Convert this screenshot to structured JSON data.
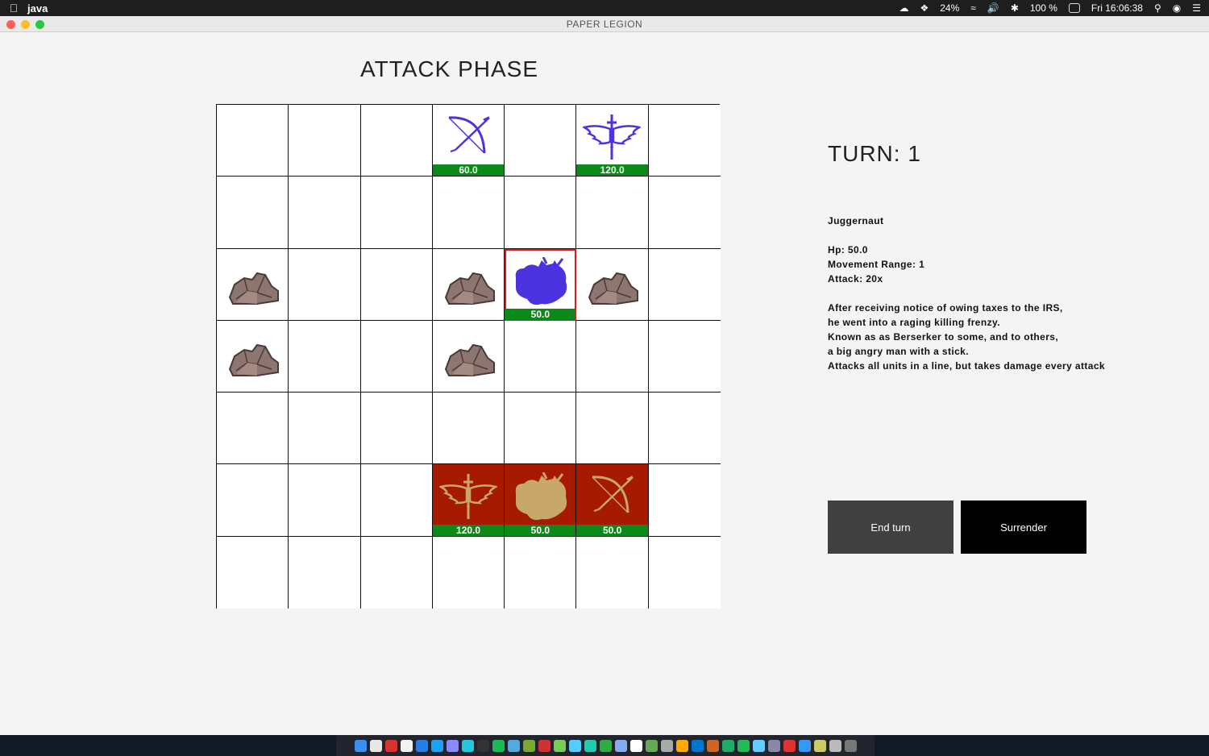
{
  "menubar": {
    "app_name": "java",
    "battery_small": "24%",
    "battery": "100 %",
    "clock": "Fri 16:06:38"
  },
  "window": {
    "title": "PAPER LEGION"
  },
  "phase_title": "ATTACK PHASE",
  "turn_label": "TURN: 1",
  "unit_info": {
    "name": "Juggernaut",
    "hp": "Hp: 50.0",
    "movement": "Movement Range: 1",
    "attack": "Attack: 20x",
    "description": [
      "After receiving notice of owing taxes to the IRS,",
      "he went into a raging killing frenzy.",
      "Known as as Berserker to some, and to others,",
      "a big angry man with a stick.",
      "Attacks all units in a line, but takes damage every attack"
    ]
  },
  "buttons": {
    "end_turn": "End turn",
    "surrender": "Surrender"
  },
  "colors": {
    "enemy_unit": "#4b34e0",
    "player_tile": "#a51a00",
    "player_unit": "#c8a86a",
    "hp_bar": "#0b8a1a",
    "selected_outline": "#e01818"
  },
  "board": {
    "rows": 7,
    "cols": 7,
    "rocks": [
      [
        2,
        0
      ],
      [
        2,
        3
      ],
      [
        2,
        5
      ],
      [
        3,
        0
      ],
      [
        3,
        3
      ]
    ],
    "units": [
      {
        "row": 0,
        "col": 3,
        "type": "archer",
        "team": "enemy",
        "hp": "60.0"
      },
      {
        "row": 0,
        "col": 5,
        "type": "angel",
        "team": "enemy",
        "hp": "120.0"
      },
      {
        "row": 2,
        "col": 4,
        "type": "juggernaut",
        "team": "enemy",
        "hp": "50.0",
        "selected": true
      },
      {
        "row": 5,
        "col": 3,
        "type": "angel",
        "team": "player",
        "hp": "120.0"
      },
      {
        "row": 5,
        "col": 4,
        "type": "juggernaut",
        "team": "player",
        "hp": "50.0"
      },
      {
        "row": 5,
        "col": 5,
        "type": "archer",
        "team": "player",
        "hp": "50.0"
      }
    ]
  }
}
